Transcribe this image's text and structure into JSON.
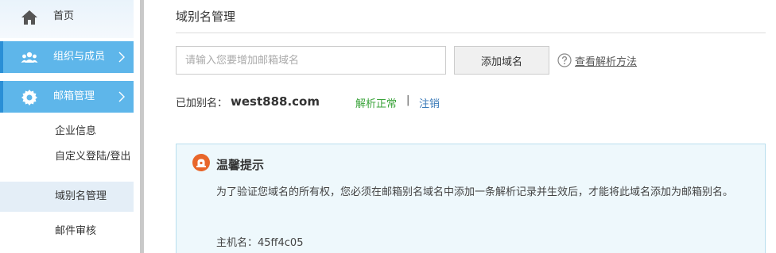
{
  "sidebar": {
    "home_label": "首页",
    "org_label": "组织与成员",
    "mail_label": "邮箱管理",
    "sub_items": [
      "企业信息",
      "自定义登陆/登出",
      "域别名管理",
      "邮件审核"
    ]
  },
  "main": {
    "title": "域别名管理",
    "input_placeholder": "请输入您要增加邮箱域名",
    "add_button": "添加域名",
    "help_link": "查看解析方法",
    "alias_label": "已加别名：",
    "alias_value": "west888.com",
    "alias_status": "解析正常",
    "alias_sep": "|",
    "alias_cancel": "注销",
    "tip_title": "温馨提示",
    "tip_text": "为了验证您域名的所有权，您必须在邮箱别名域名中添加一条解析记录并生效后，才能将此域名添加为邮箱别名。",
    "tip_host_label": "主机名：",
    "tip_host_value": "45ff4c05"
  },
  "colors": {
    "nav_active": "#5eb6ea",
    "sub_active": "#e4eef7",
    "status_ok": "#3aa33a",
    "link": "#3a7ab8",
    "tip_bg": "#eef8fc",
    "tip_icon": "#e8662a"
  },
  "icons": {
    "home": "home-icon",
    "org": "people-icon",
    "mail": "gear-icon",
    "chevron": "chevron-right-icon",
    "help": "question-circle-icon",
    "tip": "alert-lamp-icon"
  }
}
